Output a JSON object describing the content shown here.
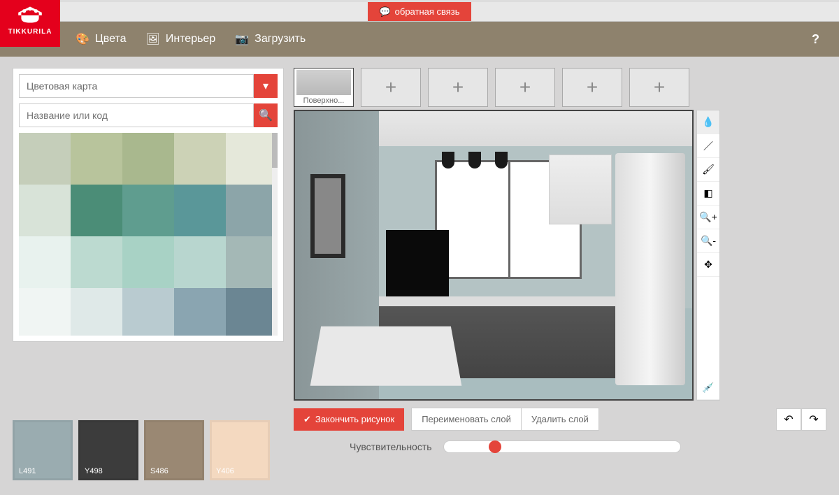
{
  "brand": "TIKKURILA",
  "feedback": "обратная связь",
  "nav": {
    "colors": "Цвета",
    "interior": "Интерьер",
    "upload": "Загрузить"
  },
  "help": "?",
  "picker": {
    "map_label": "Цветовая карта",
    "search_placeholder": "Название или код",
    "swatches": [
      "#4f5a5d",
      "#6a7478",
      "#828c8f",
      "#7d8d92",
      "#8b9ba0",
      "#6b8693",
      "#8aa5b1",
      "#b9cbd0",
      "#dfe9e8",
      "#f0f5f3",
      "#a4b8b6",
      "#b8d6cf",
      "#a8d2c5",
      "#bcdad0",
      "#e8f2ee",
      "#8ca5a9",
      "#5a9799",
      "#5f9d8f",
      "#4b8d77",
      "#d8e3d8",
      "#e5e8da",
      "#ccd2b6",
      "#a9b88e",
      "#b8c49c",
      "#c5ceba"
    ]
  },
  "selected": [
    {
      "code": "L491",
      "hex": "#9aacb0"
    },
    {
      "code": "Y498",
      "hex": "#3c3c3c"
    },
    {
      "code": "S486",
      "hex": "#9a8873"
    },
    {
      "code": "Y406",
      "hex": "#f4d9c0"
    }
  ],
  "surface": {
    "active_label": "Поверхно..."
  },
  "tools": [
    "drop",
    "line",
    "brush",
    "eraser",
    "zoom-in",
    "zoom-out",
    "move",
    "eyedropper"
  ],
  "actions": {
    "finish": "Закончить рисунок",
    "rename": "Переименовать слой",
    "delete": "Удалить слой"
  },
  "sensitivity": {
    "label": "Чувствительность"
  }
}
